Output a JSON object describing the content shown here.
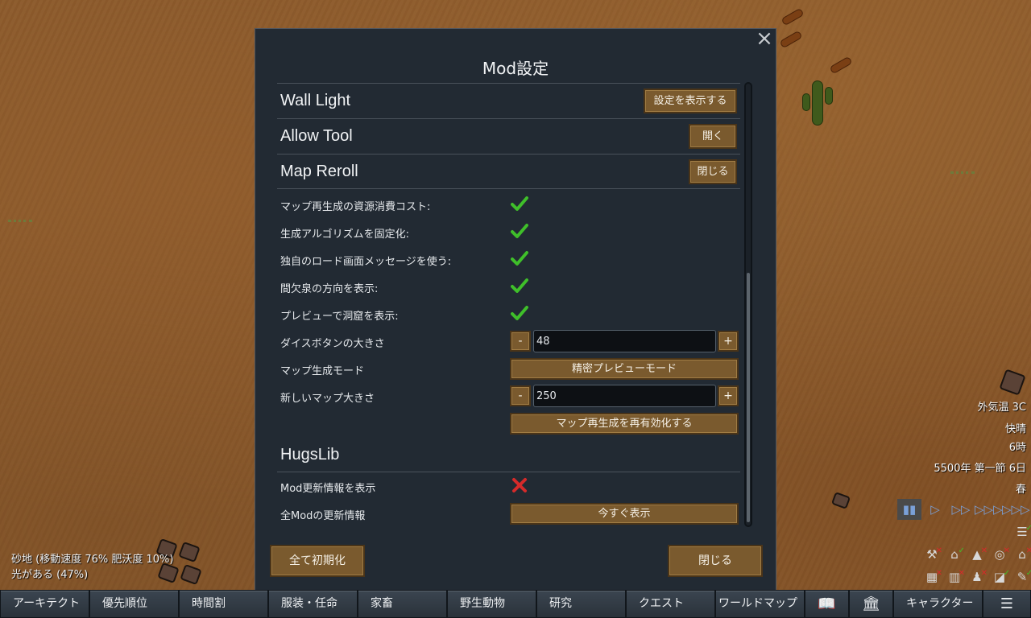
{
  "dialog": {
    "title": "Mod設定",
    "close_icon": "×",
    "sections": [
      {
        "label": "Wall Light",
        "button": "設定を表示する"
      },
      {
        "label": "Allow Tool",
        "button": "開く"
      },
      {
        "label": "Map Reroll",
        "button": "閉じる"
      }
    ],
    "map_reroll": {
      "settings": [
        {
          "label": "マップ再生成の資源消費コスト:",
          "checked": true
        },
        {
          "label": "生成アルゴリズムを固定化:",
          "checked": true
        },
        {
          "label": "独自のロード画面メッセージを使う:",
          "checked": true
        },
        {
          "label": "間欠泉の方向を表示:",
          "checked": true
        },
        {
          "label": "プレビューで洞窟を表示:",
          "checked": true
        }
      ],
      "dice_size": {
        "label": "ダイスボタンの大きさ",
        "minus": "-",
        "value": "48",
        "plus": "+"
      },
      "gen_mode": {
        "label": "マップ生成モード",
        "button": "精密プレビューモード"
      },
      "map_size": {
        "label": "新しいマップ大きさ",
        "minus": "-",
        "value": "250",
        "plus": "+"
      },
      "reenable_button": "マップ再生成を再有効化する"
    },
    "hugslib": {
      "title": "HugsLib",
      "show_updates": {
        "label": "Mod更新情報を表示",
        "checked": false
      },
      "all_updates": {
        "label": "全Modの更新情報",
        "button": "今すぐ表示"
      }
    },
    "reset_button": "全て初期化",
    "close_button": "閉じる"
  },
  "hud": {
    "terrain": "砂地 (移動速度 76% 肥沃度 10%)",
    "light": "光がある (47%)",
    "temperature": "外気温 3C",
    "weather": "快晴",
    "hour": "6時",
    "date": "5500年 第一節 6日",
    "season": "春"
  },
  "bottom_tabs": [
    "アーキテクト",
    "優先順位",
    "時間割",
    "服装・任命",
    "家畜",
    "野生動物",
    "研究",
    "クエスト",
    "ワールドマップ",
    "キャラクター"
  ],
  "colors": {
    "button": "#7a5a2e",
    "dialog_bg": "#222a33",
    "check": "#3fbf2a",
    "cross": "#d62a2a",
    "sand": "#8a5a2c"
  }
}
